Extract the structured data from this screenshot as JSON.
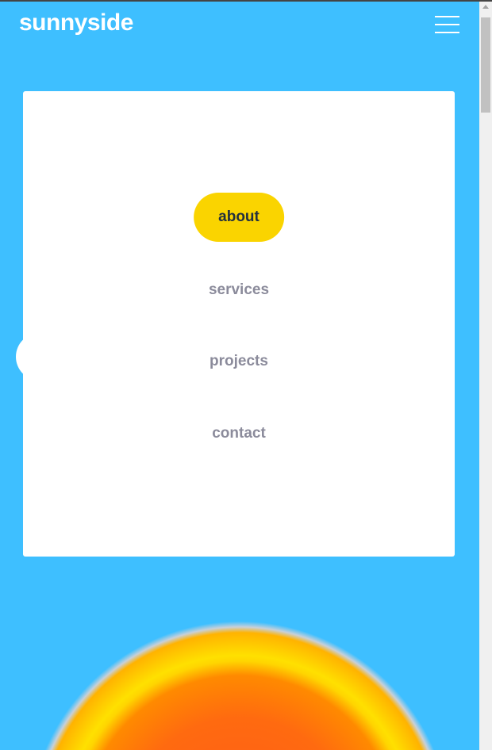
{
  "header": {
    "logo": "sunnyside",
    "menu_icon": "hamburger-icon"
  },
  "nav": {
    "items": [
      {
        "label": "about",
        "active": true
      },
      {
        "label": "services"
      },
      {
        "label": "projects"
      },
      {
        "label": "contact"
      }
    ]
  },
  "colors": {
    "background": "#3ebfff",
    "accent": "#fad400",
    "nav_text": "#8b8b9b"
  }
}
